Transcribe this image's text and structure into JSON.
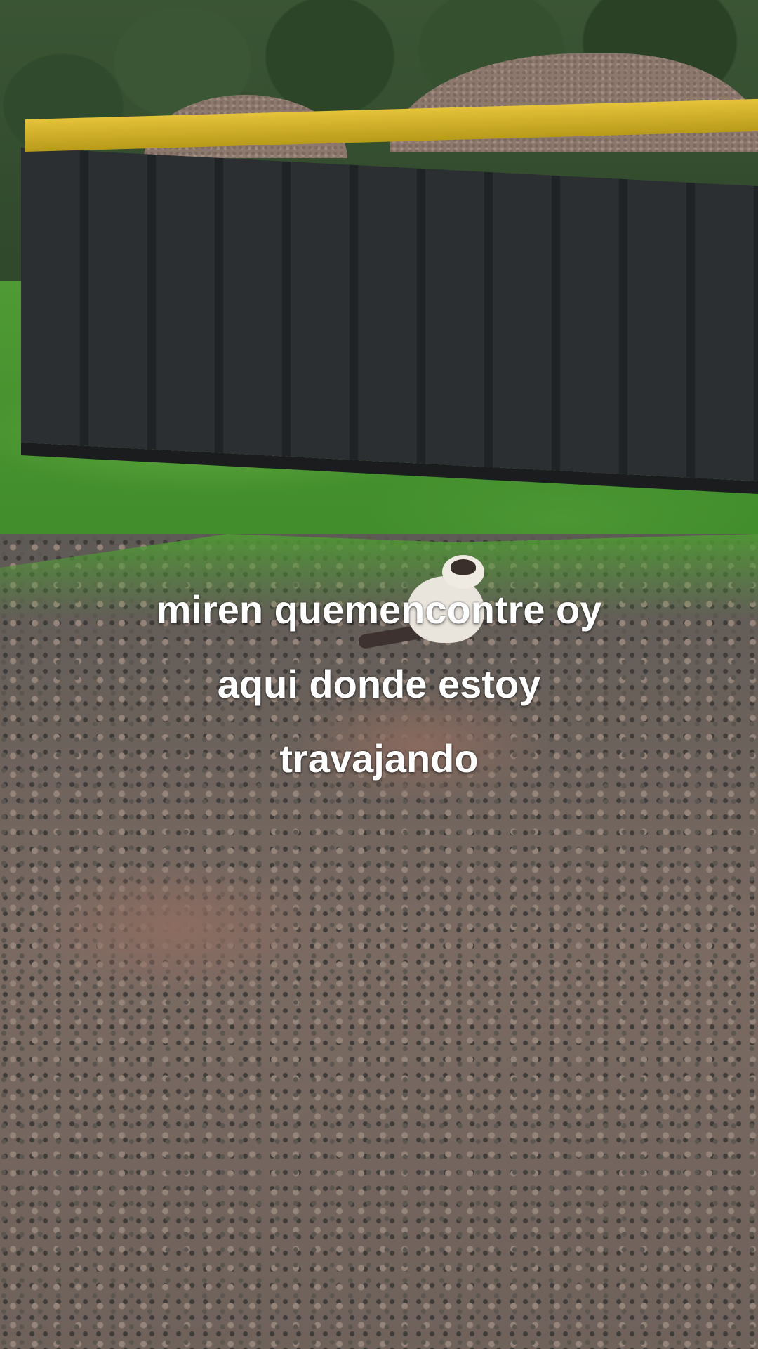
{
  "caption": {
    "lines": [
      "miren quemencontre oy",
      "aqui donde estoy",
      "travajando"
    ]
  }
}
